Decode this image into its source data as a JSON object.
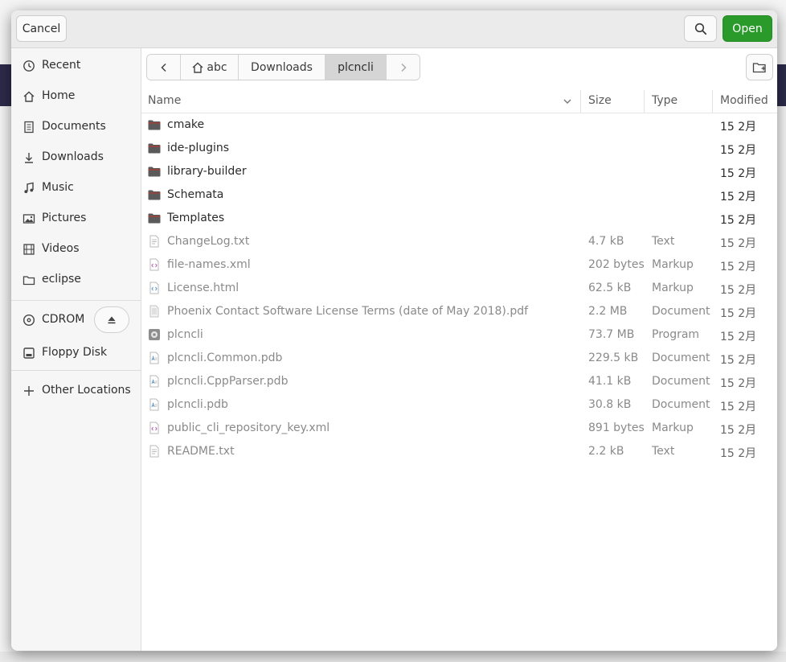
{
  "header": {
    "cancel_label": "Cancel",
    "open_label": "Open",
    "accent_color": "#2a9a2a"
  },
  "sidebar": {
    "items": [
      {
        "label": "Recent",
        "icon": "clock-icon"
      },
      {
        "label": "Home",
        "icon": "home-icon"
      },
      {
        "label": "Documents",
        "icon": "document-icon"
      },
      {
        "label": "Downloads",
        "icon": "download-icon"
      },
      {
        "label": "Music",
        "icon": "music-note-icon"
      },
      {
        "label": "Pictures",
        "icon": "picture-icon"
      },
      {
        "label": "Videos",
        "icon": "film-icon"
      },
      {
        "label": "eclipse",
        "icon": "folder-icon"
      }
    ],
    "devices": [
      {
        "label": "CDROM",
        "icon": "disc-icon"
      },
      {
        "label": "Floppy Disk",
        "icon": "drive-icon"
      }
    ],
    "other_label": "Other Locations"
  },
  "pathbar": {
    "segments": [
      "abc",
      "Downloads",
      "plcncli"
    ],
    "active_index": 2
  },
  "columns": {
    "name": "Name",
    "size": "Size",
    "type": "Type",
    "modified": "Modified"
  },
  "files": [
    {
      "name": "cmake",
      "size": "",
      "type": "",
      "modified": "15 2月",
      "kind": "folder"
    },
    {
      "name": "ide-plugins",
      "size": "",
      "type": "",
      "modified": "15 2月",
      "kind": "folder"
    },
    {
      "name": "library-builder",
      "size": "",
      "type": "",
      "modified": "15 2月",
      "kind": "folder"
    },
    {
      "name": "Schemata",
      "size": "",
      "type": "",
      "modified": "15 2月",
      "kind": "folder"
    },
    {
      "name": "Templates",
      "size": "",
      "type": "",
      "modified": "15 2月",
      "kind": "folder"
    },
    {
      "name": "ChangeLog.txt",
      "size": "4.7 kB",
      "type": "Text",
      "modified": "15 2月",
      "kind": "text"
    },
    {
      "name": "file-names.xml",
      "size": "202 bytes",
      "type": "Markup",
      "modified": "15 2月",
      "kind": "markup"
    },
    {
      "name": "License.html",
      "size": "62.5 kB",
      "type": "Markup",
      "modified": "15 2月",
      "kind": "html"
    },
    {
      "name": "Phoenix Contact Software License Terms (date of May 2018).pdf",
      "size": "2.2 MB",
      "type": "Document",
      "modified": "15 2月",
      "kind": "pdf"
    },
    {
      "name": "plcncli",
      "size": "73.7 MB",
      "type": "Program",
      "modified": "15 2月",
      "kind": "program"
    },
    {
      "name": "plcncli.Common.pdb",
      "size": "229.5 kB",
      "type": "Document",
      "modified": "15 2月",
      "kind": "doc"
    },
    {
      "name": "plcncli.CppParser.pdb",
      "size": "41.1 kB",
      "type": "Document",
      "modified": "15 2月",
      "kind": "doc"
    },
    {
      "name": "plcncli.pdb",
      "size": "30.8 kB",
      "type": "Document",
      "modified": "15 2月",
      "kind": "doc"
    },
    {
      "name": "public_cli_repository_key.xml",
      "size": "891 bytes",
      "type": "Markup",
      "modified": "15 2月",
      "kind": "markup"
    },
    {
      "name": "README.txt",
      "size": "2.2 kB",
      "type": "Text",
      "modified": "15 2月",
      "kind": "text"
    }
  ]
}
